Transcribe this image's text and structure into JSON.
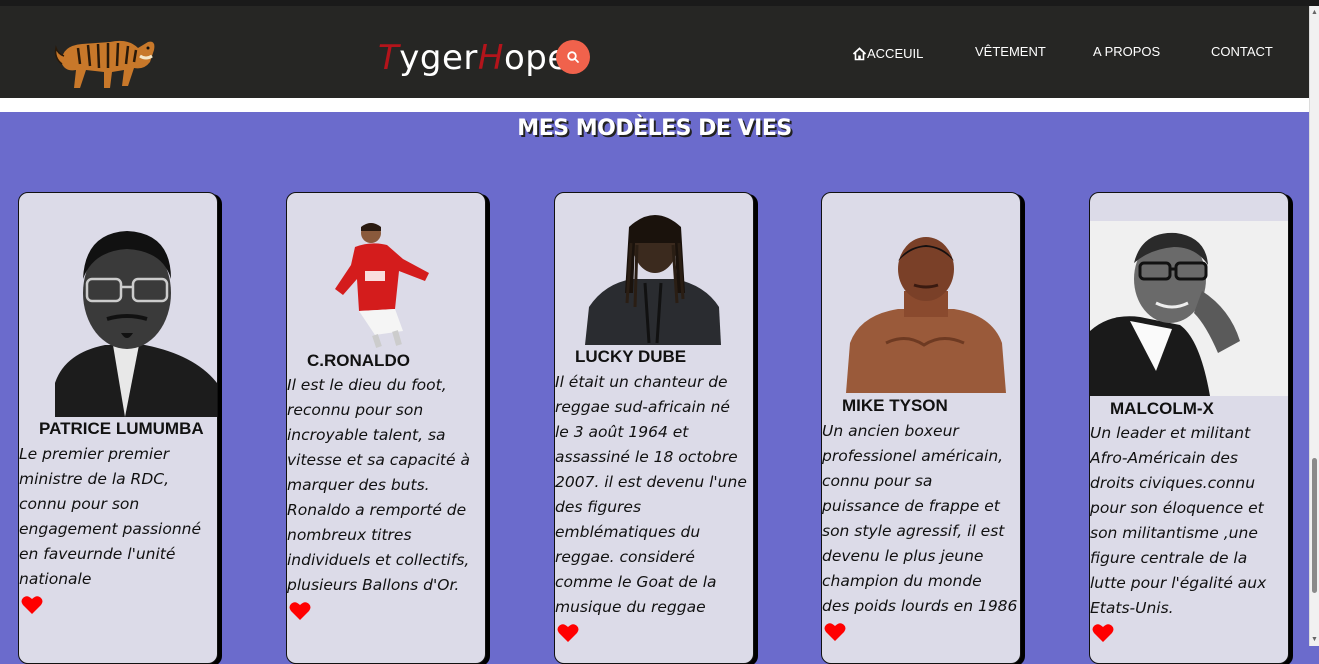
{
  "brand": {
    "first_letter": "T",
    "part1": "yger",
    "second_letter": "H",
    "part2": "ope"
  },
  "nav": {
    "home": "ACCEUIL",
    "clothing": "VÊTEMENT",
    "about": "A PROPOS",
    "contact": "CONTACT"
  },
  "section_title": "MES MODÈLES DE VIES",
  "cards": [
    {
      "name": "PATRICE LUMUMBA",
      "description": "  Le premier premier\nministre de la RDC,\nconnu pour son\nengagement passionné\nen faveurnde l'unité\nnationale"
    },
    {
      "name": "C.RONALDO",
      "description": "  Il est le dieu du foot,\nreconnu pour son\nincroyable talent, sa\nvitesse et sa capacité à\nmarquer des buts.\nRonaldo a remporté de\nnombreux titres\nindividuels et collectifs,\nplusieurs Ballons d'Or."
    },
    {
      "name": "LUCKY DUBE",
      "description": "  Il était un chanteur de\nreggae sud-africain né\nle 3 août 1964 et\nassassiné le 18 octobre\n2007. il est devenu l'une\ndes figures\nemblématiques du\nreggae. consideré\ncomme le Goat de la\nmusique du reggae"
    },
    {
      "name": "MIKE TYSON",
      "description": "  Un ancien boxeur\nprofessionel américain,\nconnu pour sa\npuissance de frappe et\nson style agressif, il est\ndevenu le plus jeune\nchampion du monde\ndes poids lourds en 1986"
    },
    {
      "name": "MALCOLM-X",
      "description": "  Un leader et militant\nAfro-Américain des\ndroits civiques.connu\npour son éloquence et\nson militantisme ,une\nfigure centrale de la\nlutte pour l'égalité aux\nEtats-Unis."
    }
  ],
  "icons": [
    "tiger-logo-icon",
    "search-icon",
    "home-icon",
    "heart-icon"
  ],
  "colors": {
    "header_bg": "#262624",
    "page_bg": "#6b6bcc",
    "card_bg": "#dcdbe8",
    "brand_accent": "#b3141b",
    "search_button": "#f0624c",
    "heart": "#ff0000"
  }
}
